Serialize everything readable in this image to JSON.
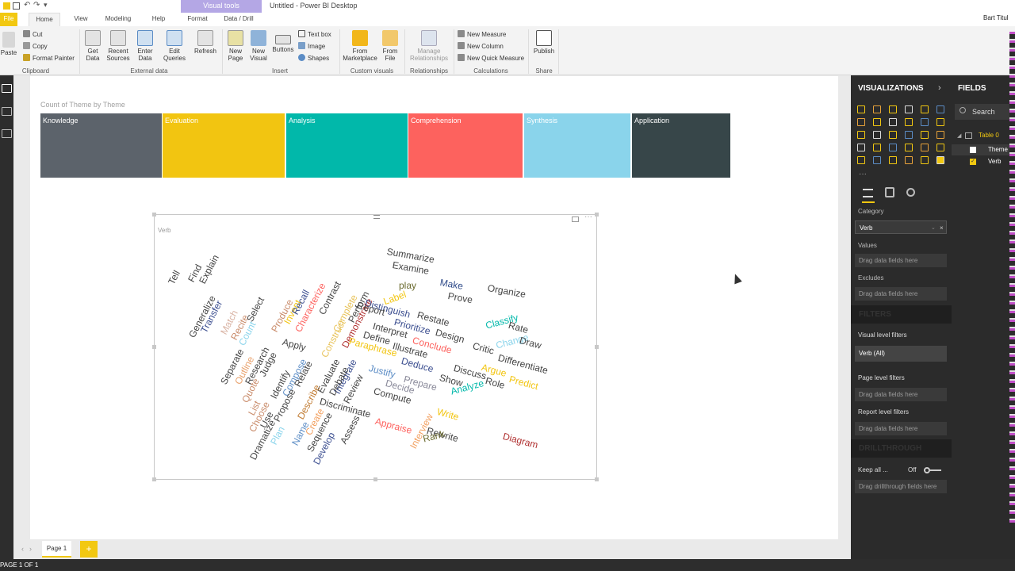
{
  "window": {
    "title": "Untitled - Power BI Desktop",
    "context_tab": "Visual tools",
    "user": "Bart Titul"
  },
  "tabs": [
    {
      "label": "File"
    },
    {
      "label": "Home"
    },
    {
      "label": "View"
    },
    {
      "label": "Modeling"
    },
    {
      "label": "Help"
    },
    {
      "label": "Format"
    },
    {
      "label": "Data / Drill"
    }
  ],
  "ribbon": {
    "paste": "Paste",
    "cut": "Cut",
    "copy": "Copy",
    "format_painter": "Format Painter",
    "get_data": "Get Data",
    "recent_sources": "Recent Sources",
    "enter_data": "Enter Data",
    "edit_queries": "Edit Queries",
    "refresh": "Refresh",
    "new_page": "New Page",
    "new_visual": "New Visual",
    "buttons": "Buttons",
    "text_box": "Text box",
    "image": "Image",
    "shapes": "Shapes",
    "from_marketplace": "From Marketplace",
    "from_file": "From File",
    "manage_relationships": "Manage Relationships",
    "new_measure": "New Measure",
    "new_column": "New Column",
    "new_quick_measure": "New Quick Measure",
    "publish": "Publish",
    "groups": {
      "clipboard": "Clipboard",
      "external_data": "External data",
      "insert": "Insert",
      "custom_visuals": "Custom visuals",
      "relationships": "Relationships",
      "calculations": "Calculations",
      "share": "Share"
    }
  },
  "treemap": {
    "title": "Count of Theme by Theme",
    "tiles": [
      {
        "label": "Knowledge",
        "color": "#5c636b"
      },
      {
        "label": "Evaluation",
        "color": "#f2c511"
      },
      {
        "label": "Analysis",
        "color": "#01b8aa"
      },
      {
        "label": "Comprehension",
        "color": "#fd625e"
      },
      {
        "label": "Synthesis",
        "color": "#8ad4eb"
      },
      {
        "label": "Application",
        "color": "#374649"
      }
    ]
  },
  "wordcloud": {
    "title": "Verb"
  },
  "page_tabs": {
    "page1": "Page 1",
    "add": "+"
  },
  "status": {
    "page": "PAGE 1 OF 1"
  },
  "visualizations": {
    "header": "VISUALIZATIONS",
    "fields_header": "FIELDS",
    "search": "Search",
    "table": "Table 0",
    "field1": "Theme",
    "field2": "Verb",
    "category_label": "Category",
    "category_value": "Verb",
    "values_label": "Values",
    "values_placeholder": "Drag data fields here",
    "excludes_label": "Excludes",
    "excludes_placeholder": "Drag data fields here",
    "filters_header": "FILTERS",
    "visual_level": "Visual level filters",
    "verb_all": "Verb (All)",
    "page_level": "Page level filters",
    "page_drag": "Drag data fields here",
    "report_level": "Report level filters",
    "report_drag": "Drag data fields here",
    "drill_header": "DRILLTHROUGH",
    "keep_all": "Keep all ...",
    "toggle": "Off",
    "drill_drag": "Drag drillthrough fields here"
  },
  "colors": {
    "accent": "#f2c811",
    "viz_bg": "#2b2b2b"
  }
}
